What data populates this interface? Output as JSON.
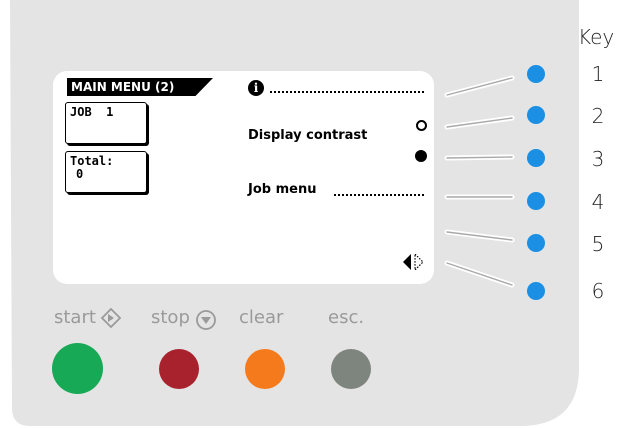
{
  "lcd": {
    "title": "MAIN MENU (2)",
    "job_box": "JOB  1",
    "total_label": "Total:",
    "total_value": "0",
    "display_contrast": "Display contrast",
    "job_menu": "Job menu"
  },
  "key_header": "Key",
  "keys": [
    "1",
    "2",
    "3",
    "4",
    "5",
    "6"
  ],
  "buttons": {
    "start": "start",
    "stop": "stop",
    "clear": "clear",
    "esc": "esc."
  },
  "colors": {
    "panel": "#e4e4e4",
    "key_led": "#1a8fe3",
    "start": "#17a955",
    "stop": "#a8222e",
    "clear": "#f57a1c",
    "esc": "#7e847e"
  },
  "icons": {
    "info": "info-icon",
    "contrast_up": "ring-icon",
    "contrast_down": "disc-icon",
    "page": "left-right-arrows-icon",
    "start": "diamond-icon",
    "stop": "stop-triangle-icon"
  }
}
